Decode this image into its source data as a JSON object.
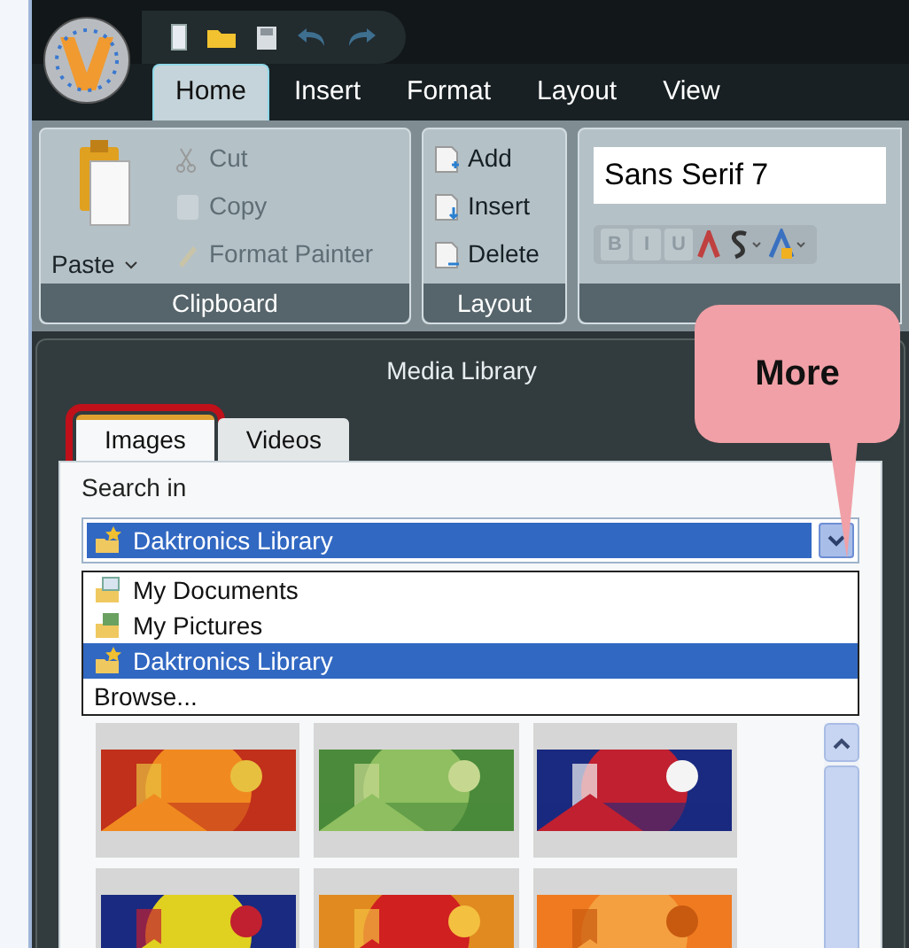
{
  "ribbon_tabs": [
    {
      "label": "Home",
      "selected": true
    },
    {
      "label": "Insert",
      "selected": false
    },
    {
      "label": "Format",
      "selected": false
    },
    {
      "label": "Layout",
      "selected": false
    },
    {
      "label": "View",
      "selected": false
    }
  ],
  "clipboard": {
    "paste": "Paste",
    "commands": [
      {
        "label": "Cut",
        "kind": "cut",
        "disabled": true
      },
      {
        "label": "Copy",
        "kind": "copy",
        "disabled": true
      },
      {
        "label": "Format Painter",
        "kind": "painter",
        "disabled": true
      }
    ],
    "group_label": "Clipboard"
  },
  "layout": {
    "commands": [
      {
        "label": "Add",
        "kind": "add"
      },
      {
        "label": "Insert",
        "kind": "insert"
      },
      {
        "label": "Delete",
        "kind": "delete"
      }
    ],
    "group_label": "Layout"
  },
  "font": {
    "value": "Sans Serif 7",
    "styles": [
      {
        "label": "B",
        "disabled": true
      },
      {
        "label": "I",
        "disabled": true
      },
      {
        "label": "U",
        "disabled": true
      }
    ]
  },
  "media_library": {
    "title": "Media Library",
    "tabs": [
      {
        "label": "Images",
        "selected": true,
        "highlighted": true
      },
      {
        "label": "Videos",
        "selected": false,
        "highlighted": false
      }
    ],
    "search_label": "Search in",
    "search_value": "Daktronics Library",
    "options": [
      {
        "label": "My Documents",
        "kind": "documents",
        "selected": false
      },
      {
        "label": "My Pictures",
        "kind": "pictures",
        "selected": false
      },
      {
        "label": "Daktronics Library",
        "kind": "library",
        "selected": true
      },
      {
        "label": "Browse...",
        "kind": "plain",
        "selected": false
      }
    ]
  },
  "callout": {
    "text": "More"
  }
}
